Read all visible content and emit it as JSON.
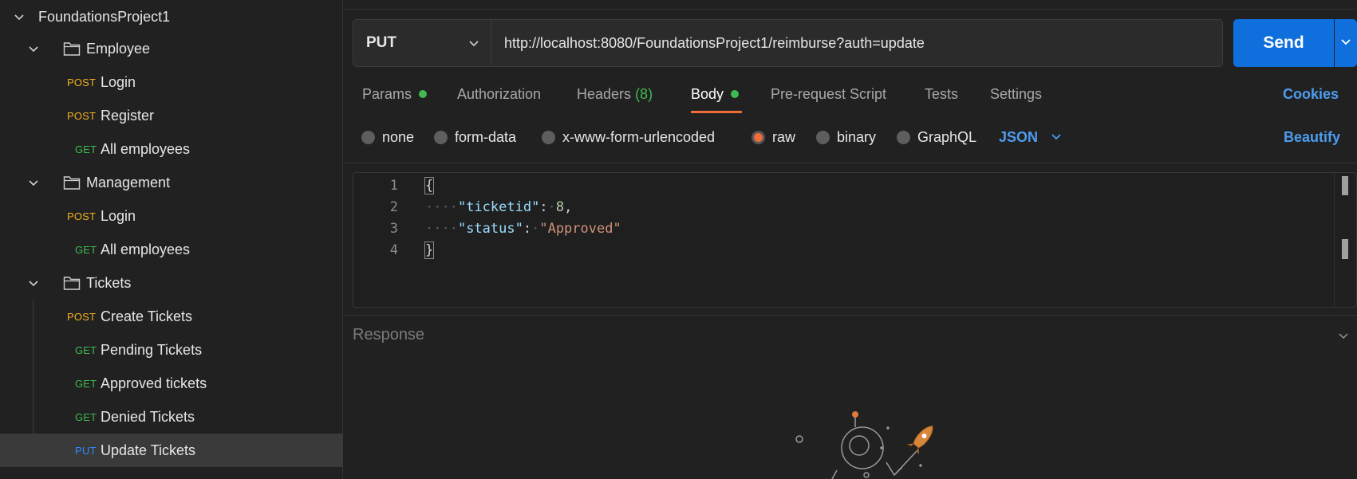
{
  "sidebar": {
    "collection": "FoundationsProject1",
    "folders": [
      {
        "name": "Employee",
        "requests": [
          {
            "method": "POST",
            "name": "Login"
          },
          {
            "method": "POST",
            "name": "Register"
          },
          {
            "method": "GET",
            "name": "All employees"
          }
        ]
      },
      {
        "name": "Management",
        "requests": [
          {
            "method": "POST",
            "name": "Login"
          },
          {
            "method": "GET",
            "name": "All employees"
          }
        ]
      },
      {
        "name": "Tickets",
        "requests": [
          {
            "method": "POST",
            "name": "Create Tickets"
          },
          {
            "method": "GET",
            "name": "Pending Tickets"
          },
          {
            "method": "GET",
            "name": "Approved tickets"
          },
          {
            "method": "GET",
            "name": "Denied Tickets"
          },
          {
            "method": "PUT",
            "name": "Update Tickets"
          }
        ]
      }
    ]
  },
  "request": {
    "method": "PUT",
    "url": "http://localhost:8080/FoundationsProject1/reimburse?auth=update",
    "send_label": "Send"
  },
  "tabs": {
    "params": "Params",
    "authorization": "Authorization",
    "headers": "Headers",
    "headers_count": "(8)",
    "body": "Body",
    "prerequest": "Pre-request Script",
    "tests": "Tests",
    "settings": "Settings",
    "cookies": "Cookies"
  },
  "body_types": {
    "none": "none",
    "form_data": "form-data",
    "urlencoded": "x-www-form-urlencoded",
    "raw": "raw",
    "binary": "binary",
    "graphql": "GraphQL",
    "format": "JSON",
    "beautify": "Beautify"
  },
  "editor": {
    "line_numbers": [
      "1",
      "2",
      "3",
      "4"
    ],
    "open_brace": "{",
    "close_brace": "}",
    "key1": "\"ticketid\"",
    "val1": "8",
    "key2": "\"status\"",
    "val2": "\"Approved\""
  },
  "response": {
    "label": "Response"
  },
  "colors": {
    "post": "#f2b01e",
    "get": "#3fb950",
    "put": "#2f88ff",
    "accent": "#f26b3a",
    "send": "#0f6fdc"
  }
}
